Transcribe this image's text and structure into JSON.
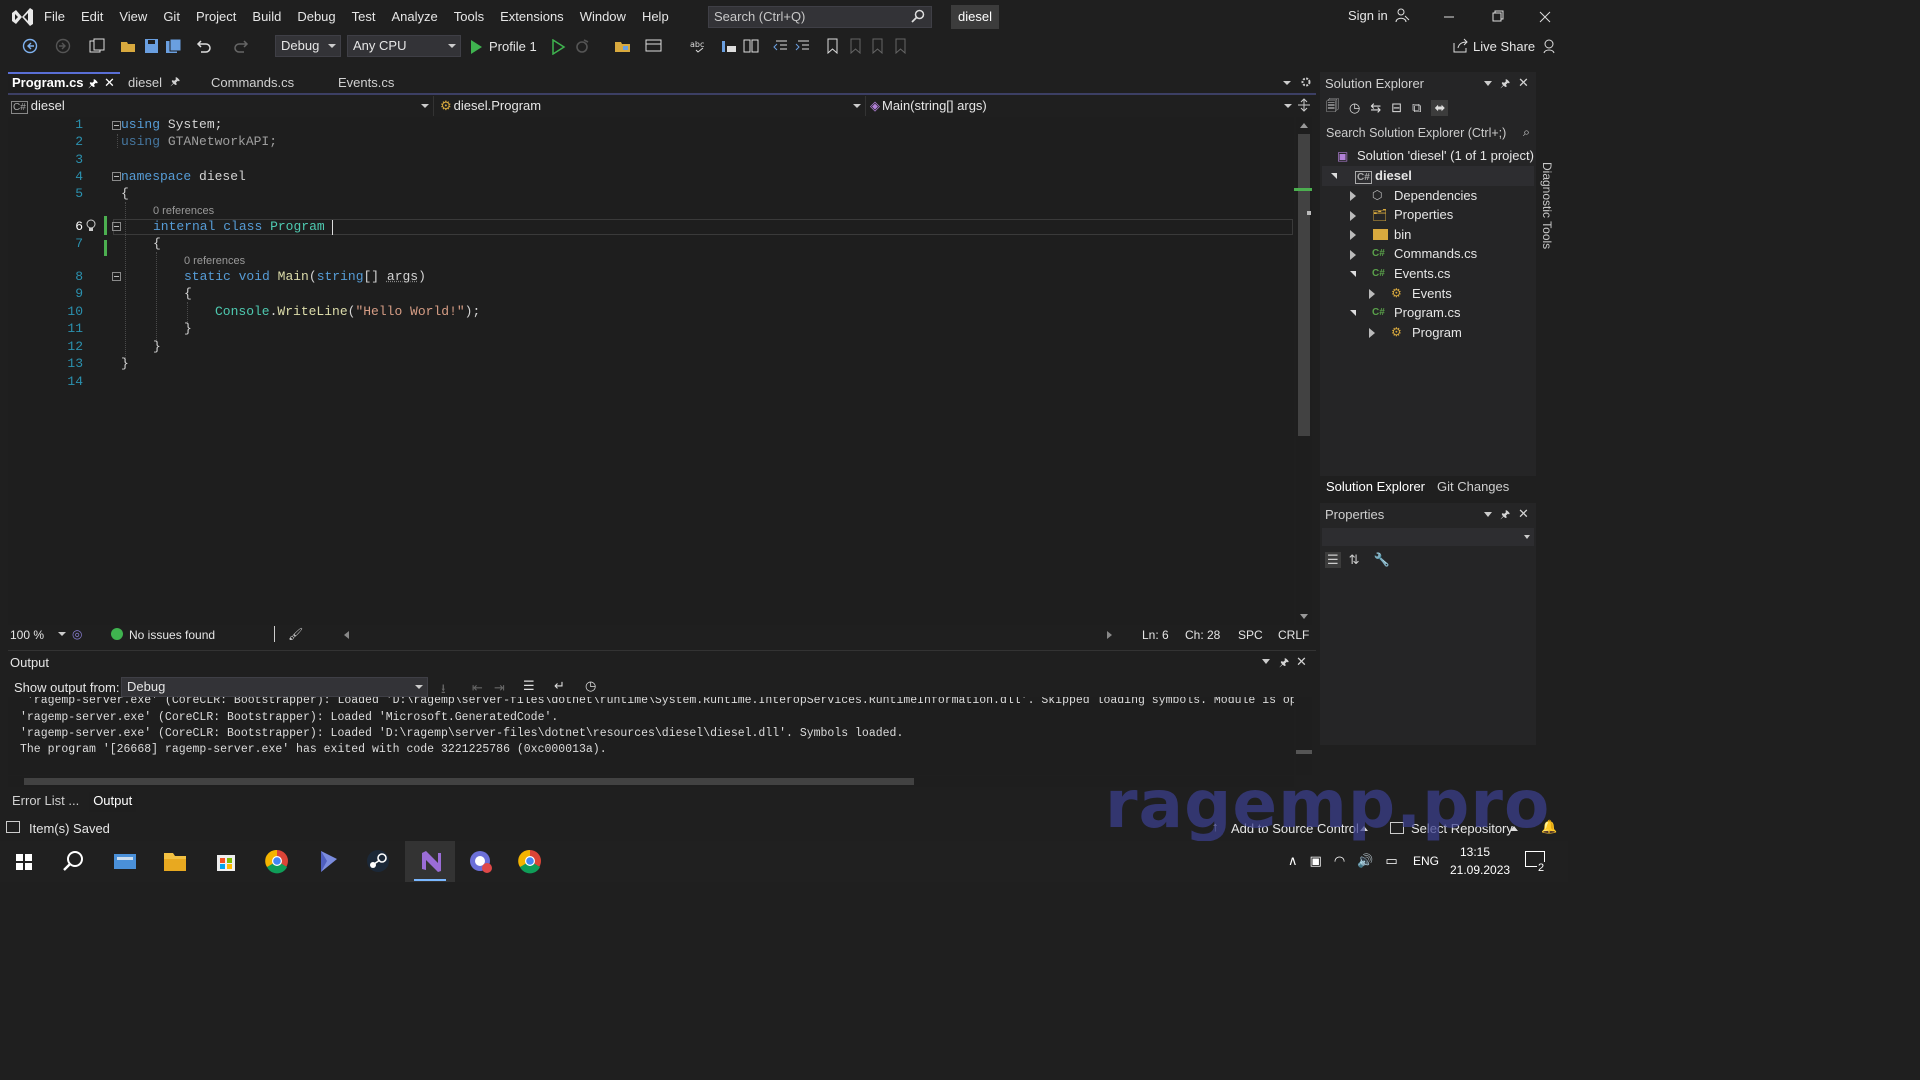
{
  "menu": [
    "File",
    "Edit",
    "View",
    "Git",
    "Project",
    "Build",
    "Debug",
    "Test",
    "Analyze",
    "Tools",
    "Extensions",
    "Window",
    "Help"
  ],
  "search": {
    "placeholder": "Search (Ctrl+Q)"
  },
  "solution_badge": "diesel",
  "signin": "Sign in",
  "toolbar": {
    "config": "Debug",
    "platform": "Any CPU",
    "run_label": "Profile 1",
    "live_share": "Live Share"
  },
  "doc_tabs": [
    "Program.cs",
    "diesel",
    "Commands.cs",
    "Events.cs"
  ],
  "nav": {
    "project": "diesel",
    "type": "diesel.Program",
    "member": "Main(string[] args)"
  },
  "editor": {
    "line_numbers": [
      "1",
      "2",
      "3",
      "4",
      "5",
      "6",
      "7",
      "8",
      "9",
      "10",
      "11",
      "12",
      "13",
      "14"
    ],
    "lens": [
      "0 references",
      "0 references"
    ],
    "code": {
      "l1_kw": "using",
      "l1_rest": " System;",
      "l2_kw": "using",
      "l2_rest": " GTANetworkAPI;",
      "l4_kw": "namespace",
      "l4_rest": " diesel",
      "open_brace": "{",
      "close_brace": "}",
      "l6_kw1": "internal",
      "l6_kw2": "class",
      "l6_type": "Program",
      "l8_kw1": "static",
      "l8_kw2": "void",
      "l8_fn": "Main",
      "l8_p1": "(",
      "l8_kw3": "string",
      "l8_p2": "[] ",
      "l8_arg": "args",
      "l8_p3": ")",
      "l10_type": "Console",
      "l10_dot": ".",
      "l10_fn": "WriteLine",
      "l10_p1": "(",
      "l10_str": "\"Hello World!\"",
      "l10_p2": ");"
    }
  },
  "editor_status": {
    "zoom": "100 %",
    "issues": "No issues found",
    "ln": "Ln: 6",
    "ch": "Ch: 28",
    "spc": "SPC",
    "crlf": "CRLF"
  },
  "output": {
    "title": "Output",
    "show_from_label": "Show output from:",
    "source": "Debug",
    "lines": [
      " 'ragemp-server.exe' (CoreCLR: Bootstrapper): Loaded 'D:\\ragemp\\server-files\\dotnet\\runtime\\System.Runtime.InteropServices.RuntimeInformation.dll'. Skipped loading symbols. Module is optimized and",
      "'ragemp-server.exe' (CoreCLR: Bootstrapper): Loaded 'Microsoft.GeneratedCode'.",
      "'ragemp-server.exe' (CoreCLR: Bootstrapper): Loaded 'D:\\ragemp\\server-files\\dotnet\\resources\\diesel\\diesel.dll'. Symbols loaded.",
      "The program '[26668] ragemp-server.exe' has exited with code 3221225786 (0xc000013a)."
    ]
  },
  "bottom_tabs": [
    "Error List ...",
    "Output"
  ],
  "statusbar": {
    "message": "Item(s) Saved",
    "source_control": "Add to Source Control",
    "repository": "Select Repository"
  },
  "solution_explorer": {
    "title": "Solution Explorer",
    "search_placeholder": "Search Solution Explorer (Ctrl+;)",
    "items": [
      "Solution 'diesel' (1 of 1 project)",
      "diesel",
      "Dependencies",
      "Properties",
      "bin",
      "Commands.cs",
      "Events.cs",
      "Events",
      "Program.cs",
      "Program"
    ],
    "cs_badge": "C#",
    "tabs": [
      "Solution Explorer",
      "Git Changes"
    ]
  },
  "properties": {
    "title": "Properties"
  },
  "diagnostic_tools": "Diagnostic Tools",
  "watermark": "ragemp.pro",
  "taskbar": {
    "lang": "ENG",
    "time": "13:15",
    "date": "21.09.2023",
    "notif_count": "2"
  },
  "colors": {
    "keyword": "#569cd6",
    "type": "#4ec9b0",
    "method": "#dcdcaa",
    "string": "#d69d85",
    "line_number": "#2b91af",
    "accent": "#5a6fd6",
    "watermark": "#3b3f8f"
  }
}
